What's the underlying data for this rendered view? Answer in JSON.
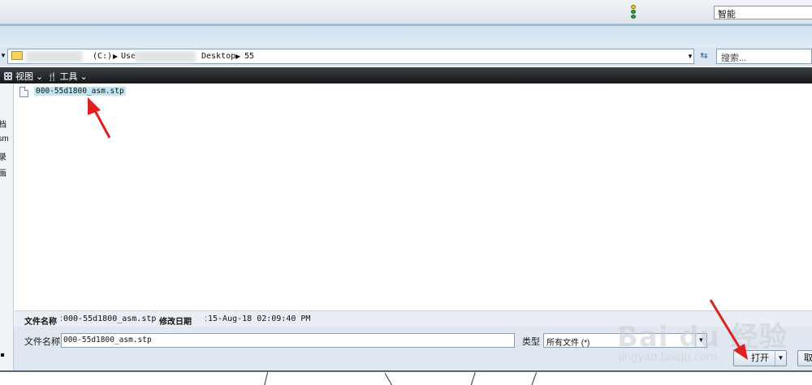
{
  "app": {
    "smart_field": "智能",
    "indicator_icon": "traffic-light-icon"
  },
  "address": {
    "drive": "(C:)",
    "user_segment": "Use",
    "desktop": "Desktop",
    "folder": "55",
    "search_placeholder": "搜索..."
  },
  "toolbar": {
    "view_label": "视图",
    "tools_label": "工具"
  },
  "nav": {
    "items": [
      "档",
      "rsm",
      "录",
      "画"
    ]
  },
  "files": [
    {
      "name": "000-55d1800_asm.stp",
      "selected": true
    }
  ],
  "details": {
    "name_label": "文件名称",
    "name_value": "000-55d1800_asm.stp",
    "modified_label": "修改日期",
    "modified_value": "15-Aug-18 02:09:40 PM"
  },
  "form": {
    "filename_label": "文件名称",
    "filename_value": "000-55d1800_asm.stp",
    "type_label": "类型",
    "type_value": "所有文件 (*)",
    "open_button": "打开",
    "cancel_button": "取"
  },
  "watermark": {
    "main": "Bai du 经验",
    "sub": "jingyan.baidu.com"
  },
  "colors": {
    "annotation": "#e02020",
    "selection": "#bfe7f3",
    "toolbar": "#22262a"
  }
}
